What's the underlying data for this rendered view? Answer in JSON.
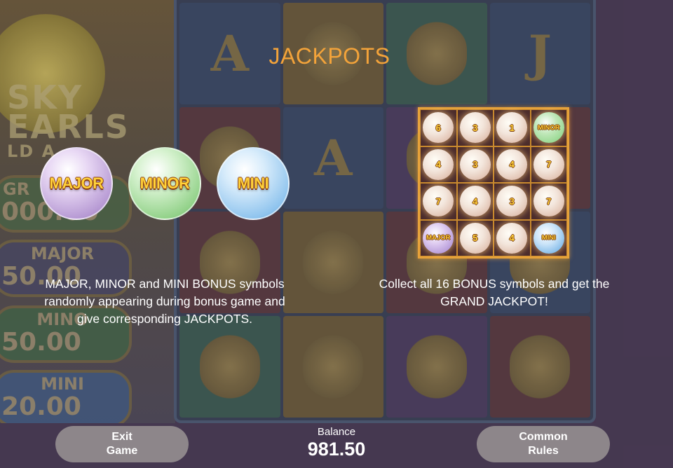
{
  "title": "JACKPOTS",
  "orbs": {
    "major": "MAJOR",
    "minor": "MINOR",
    "mini": "MINI"
  },
  "descriptions": {
    "left": [
      "MAJOR, MINOR and MINI BONUS symbols",
      "randomly appearing during bonus game and",
      "give corresponding JACKPOTS."
    ],
    "right": [
      "Collect all 16 BONUS symbols and get the",
      "GRAND JACKPOT!"
    ]
  },
  "grid": [
    [
      "6",
      "3",
      "1",
      "MINOR"
    ],
    [
      "4",
      "3",
      "4",
      "7"
    ],
    [
      "7",
      "4",
      "3",
      "7"
    ],
    [
      "MAJOR",
      "5",
      "4",
      "MINI"
    ]
  ],
  "background": {
    "logo": [
      "SKY",
      "EARLS",
      "LD A"
    ],
    "jackpots": [
      {
        "label": "GR",
        "value": "000.00"
      },
      {
        "label": "MAJOR",
        "value": "50.00"
      },
      {
        "label": "MINO",
        "value": "50.00"
      },
      {
        "label": "MINI",
        "value": "20.00"
      }
    ],
    "reel_glyphs": [
      "A",
      "J",
      "A"
    ]
  },
  "controls": {
    "exit": [
      "Exit",
      "Game"
    ],
    "balance_label": "Balance",
    "balance_value": "981.50",
    "rules": [
      "Common",
      "Rules"
    ]
  },
  "colors": {
    "title": "#f3a33a",
    "button": "#8d868a",
    "panel_border": "#e6a23a"
  }
}
